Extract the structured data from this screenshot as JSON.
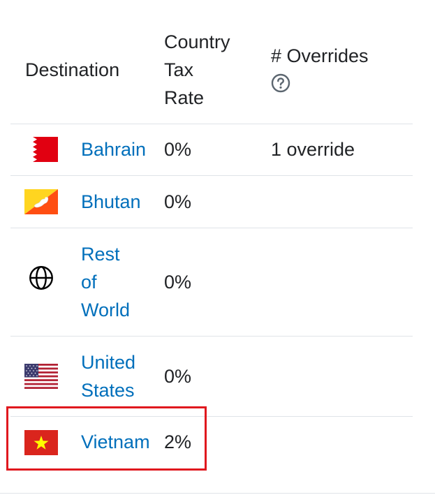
{
  "table": {
    "headers": {
      "destination": "Destination",
      "rate_line1": "Country",
      "rate_line2": "Tax",
      "rate_line3": "Rate",
      "overrides": "# Overrides",
      "overrides_help_icon": "question-circle-icon"
    },
    "rows": [
      {
        "flag_icon": "bahrain-flag-icon",
        "name": "Bahrain",
        "rate": "0%",
        "overrides": "1 override"
      },
      {
        "flag_icon": "bhutan-flag-icon",
        "name": "Bhutan",
        "rate": "0%",
        "overrides": ""
      },
      {
        "flag_icon": "globe-icon",
        "name_line1": "Rest",
        "name_line2": "of",
        "name_line3": "World",
        "rate": "0%",
        "overrides": ""
      },
      {
        "flag_icon": "united-states-flag-icon",
        "name_line1": "United",
        "name_line2": "States",
        "rate": "0%",
        "overrides": ""
      },
      {
        "flag_icon": "vietnam-flag-icon",
        "name": "Vietnam",
        "rate": "2%",
        "overrides": ""
      }
    ]
  },
  "colors": {
    "link": "#006fbb",
    "text": "#212326",
    "divider": "#dfe3e8",
    "highlight": "#e0181e"
  }
}
